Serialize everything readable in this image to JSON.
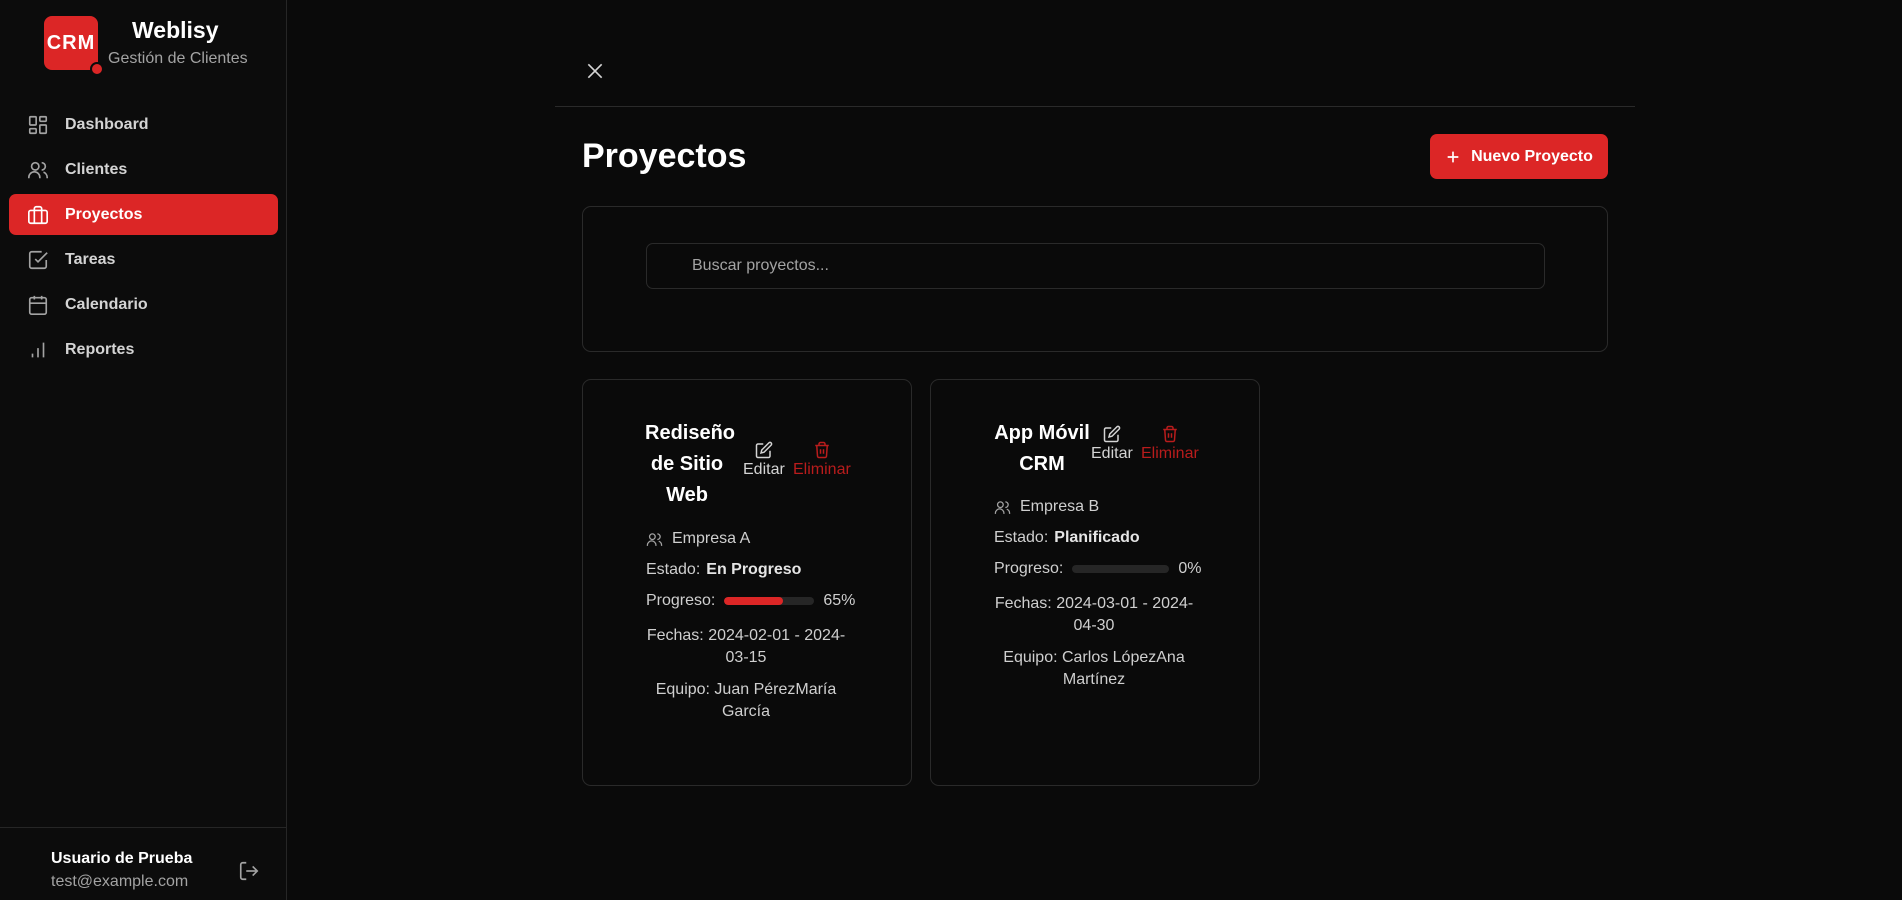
{
  "brand": {
    "logo_text": "CRM",
    "name": "Weblisy",
    "subtitle": "Gestión de Clientes"
  },
  "nav": {
    "items": [
      {
        "label": "Dashboard",
        "icon": "dashboard-icon"
      },
      {
        "label": "Clientes",
        "icon": "users-icon"
      },
      {
        "label": "Proyectos",
        "icon": "briefcase-icon",
        "active": true
      },
      {
        "label": "Tareas",
        "icon": "check-square-icon"
      },
      {
        "label": "Calendario",
        "icon": "calendar-icon"
      },
      {
        "label": "Reportes",
        "icon": "bar-chart-icon"
      }
    ]
  },
  "user": {
    "name": "Usuario de Prueba",
    "email": "test@example.com"
  },
  "page": {
    "title": "Proyectos",
    "new_button": "Nuevo Proyecto"
  },
  "search": {
    "placeholder": "Buscar proyectos..."
  },
  "projects": [
    {
      "title": "Rediseño de Sitio Web",
      "edit_label": "Editar",
      "delete_label": "Eliminar",
      "client": "Empresa A",
      "status_label": "Estado:",
      "status": "En Progreso",
      "progress_label": "Progreso:",
      "progress": 65,
      "progress_text": "65%",
      "dates": "Fechas: 2024-02-01 - 2024-03-15",
      "team": "Equipo: Juan PérezMaría García"
    },
    {
      "title": "App Móvil CRM",
      "edit_label": "Editar",
      "delete_label": "Eliminar",
      "client": "Empresa B",
      "status_label": "Estado:",
      "status": "Planificado",
      "progress_label": "Progreso:",
      "progress": 0,
      "progress_text": "0%",
      "dates": "Fechas: 2024-03-01 - 2024-04-30",
      "team": "Equipo: Carlos LópezAna Martínez"
    }
  ],
  "colors": {
    "accent": "#dc2626",
    "background": "#0a0a0a",
    "border": "#2a2a2a"
  }
}
